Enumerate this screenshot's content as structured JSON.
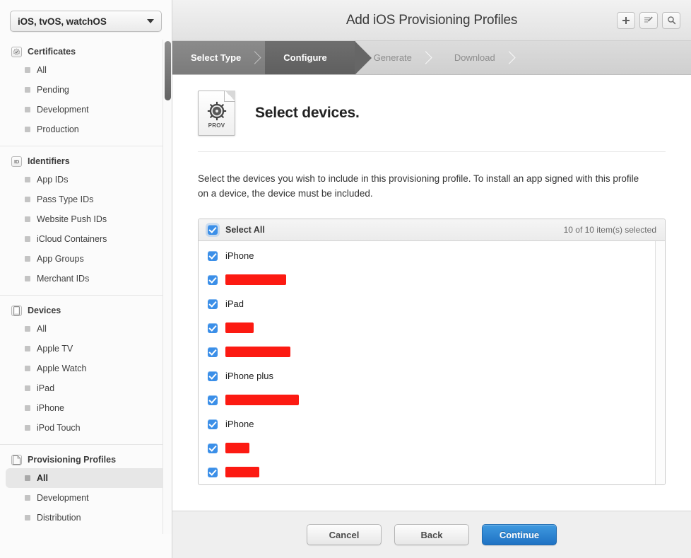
{
  "sidebar": {
    "platform_selector": {
      "value": "iOS, tvOS, watchOS",
      "icon": "chevron-down-icon"
    },
    "groups": [
      {
        "title": "Certificates",
        "icon": "certificate-seal-icon",
        "items": [
          {
            "label": "All",
            "selected": false
          },
          {
            "label": "Pending",
            "selected": false
          },
          {
            "label": "Development",
            "selected": false
          },
          {
            "label": "Production",
            "selected": false
          }
        ]
      },
      {
        "title": "Identifiers",
        "icon": "id-badge-icon",
        "items": [
          {
            "label": "App IDs",
            "selected": false
          },
          {
            "label": "Pass Type IDs",
            "selected": false
          },
          {
            "label": "Website Push IDs",
            "selected": false
          },
          {
            "label": "iCloud Containers",
            "selected": false
          },
          {
            "label": "App Groups",
            "selected": false
          },
          {
            "label": "Merchant IDs",
            "selected": false
          }
        ]
      },
      {
        "title": "Devices",
        "icon": "device-phone-icon",
        "items": [
          {
            "label": "All",
            "selected": false
          },
          {
            "label": "Apple TV",
            "selected": false
          },
          {
            "label": "Apple Watch",
            "selected": false
          },
          {
            "label": "iPad",
            "selected": false
          },
          {
            "label": "iPhone",
            "selected": false
          },
          {
            "label": "iPod Touch",
            "selected": false
          }
        ]
      },
      {
        "title": "Provisioning Profiles",
        "icon": "document-icon",
        "items": [
          {
            "label": "All",
            "selected": true
          },
          {
            "label": "Development",
            "selected": false
          },
          {
            "label": "Distribution",
            "selected": false
          }
        ]
      }
    ]
  },
  "header": {
    "title": "Add iOS Provisioning Profiles",
    "tools": [
      {
        "name": "add-button",
        "icon": "plus-icon"
      },
      {
        "name": "edit-button",
        "icon": "edit-pencil-icon"
      },
      {
        "name": "search-button",
        "icon": "search-icon"
      }
    ]
  },
  "steps": [
    {
      "label": "Select Type",
      "state": "done"
    },
    {
      "label": "Configure",
      "state": "active"
    },
    {
      "label": "Generate",
      "state": "inactive"
    },
    {
      "label": "Download",
      "state": "inactive"
    }
  ],
  "main": {
    "icon_label": "PROV",
    "icon_name": "provisioning-profile-icon",
    "heading": "Select devices.",
    "description": "Select the devices you wish to include in this provisioning profile. To install an app signed with this profile on a device, the device must be included."
  },
  "device_list": {
    "select_all_label": "Select All",
    "select_all_checked": true,
    "selection_status": "10  of 10 item(s) selected",
    "selected_count": 10,
    "total_count": 10,
    "rows": [
      {
        "name": "iPhone",
        "checked": true,
        "redacted": false,
        "redaction_width": 0
      },
      {
        "name": "",
        "checked": true,
        "redacted": true,
        "redaction_width": 86
      },
      {
        "name": "iPad",
        "checked": true,
        "redacted": false,
        "redaction_width": 0
      },
      {
        "name": "",
        "checked": true,
        "redacted": true,
        "redaction_width": 40
      },
      {
        "name": "",
        "checked": true,
        "redacted": true,
        "redaction_width": 92
      },
      {
        "name": "iPhone plus",
        "checked": true,
        "redacted": false,
        "redaction_width": 0
      },
      {
        "name": "",
        "checked": true,
        "redacted": true,
        "redaction_width": 104
      },
      {
        "name": "iPhone",
        "checked": true,
        "redacted": false,
        "redaction_width": 0
      },
      {
        "name": "",
        "checked": true,
        "redacted": true,
        "redaction_width": 34
      },
      {
        "name": "",
        "checked": true,
        "redacted": true,
        "redaction_width": 48
      }
    ]
  },
  "footer": {
    "cancel_label": "Cancel",
    "back_label": "Back",
    "continue_label": "Continue"
  },
  "colors": {
    "accent_blue": "#3b8fe8",
    "primary_button": "#2a7fca",
    "redaction_red": "#fc1a12",
    "step_active": "#656565"
  }
}
